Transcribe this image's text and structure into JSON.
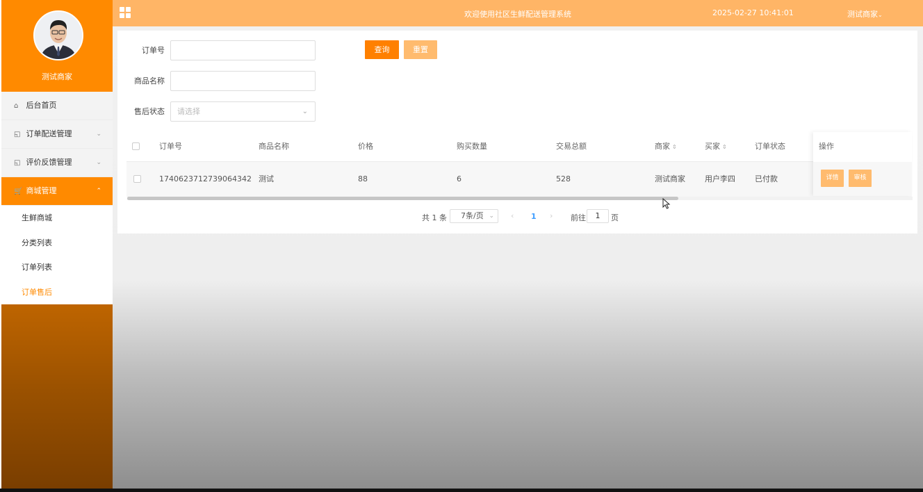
{
  "sidebar": {
    "profile_name": "测试商家",
    "menu": [
      {
        "label": "后台首页",
        "icon": "home-icon"
      },
      {
        "label": "订单配送管理",
        "icon": "external-link-icon"
      },
      {
        "label": "评价反馈管理",
        "icon": "external-link-icon"
      },
      {
        "label": "商城管理",
        "icon": "cart-icon"
      }
    ],
    "submenu": [
      {
        "label": "生鲜商城"
      },
      {
        "label": "分类列表"
      },
      {
        "label": "订单列表"
      },
      {
        "label": "订单售后"
      }
    ]
  },
  "topbar": {
    "title": "欢迎使用社区生鲜配送管理系统",
    "datetime": "2025-02-27 10:41:01",
    "user": "测试商家"
  },
  "search": {
    "order_no_label": "订单号",
    "order_no_value": "",
    "product_label": "商品名称",
    "product_value": "",
    "status_label": "售后状态",
    "status_placeholder": "请选择",
    "query_button": "查询",
    "reset_button": "重置"
  },
  "table": {
    "headers": [
      "订单号",
      "商品名称",
      "价格",
      "购买数量",
      "交易总额",
      "商家",
      "买家",
      "订单状态",
      "操作"
    ],
    "rows": [
      {
        "order_no": "1740623712739064342",
        "product": "测试",
        "price": "88",
        "quantity": "6",
        "total": "528",
        "merchant": "测试商家",
        "buyer": "用户李四",
        "status": "已付款",
        "detail_button": "详情",
        "review_button": "审核"
      }
    ]
  },
  "pagination": {
    "total": "共 1 条",
    "page_size": "7条/页",
    "current_page": "1",
    "goto_label": "前往",
    "goto_value": "1",
    "page_unit": "页"
  },
  "colors": {
    "accent": "#ff8000",
    "topbar": "#ffb566",
    "button_light": "#ffbb6e"
  }
}
